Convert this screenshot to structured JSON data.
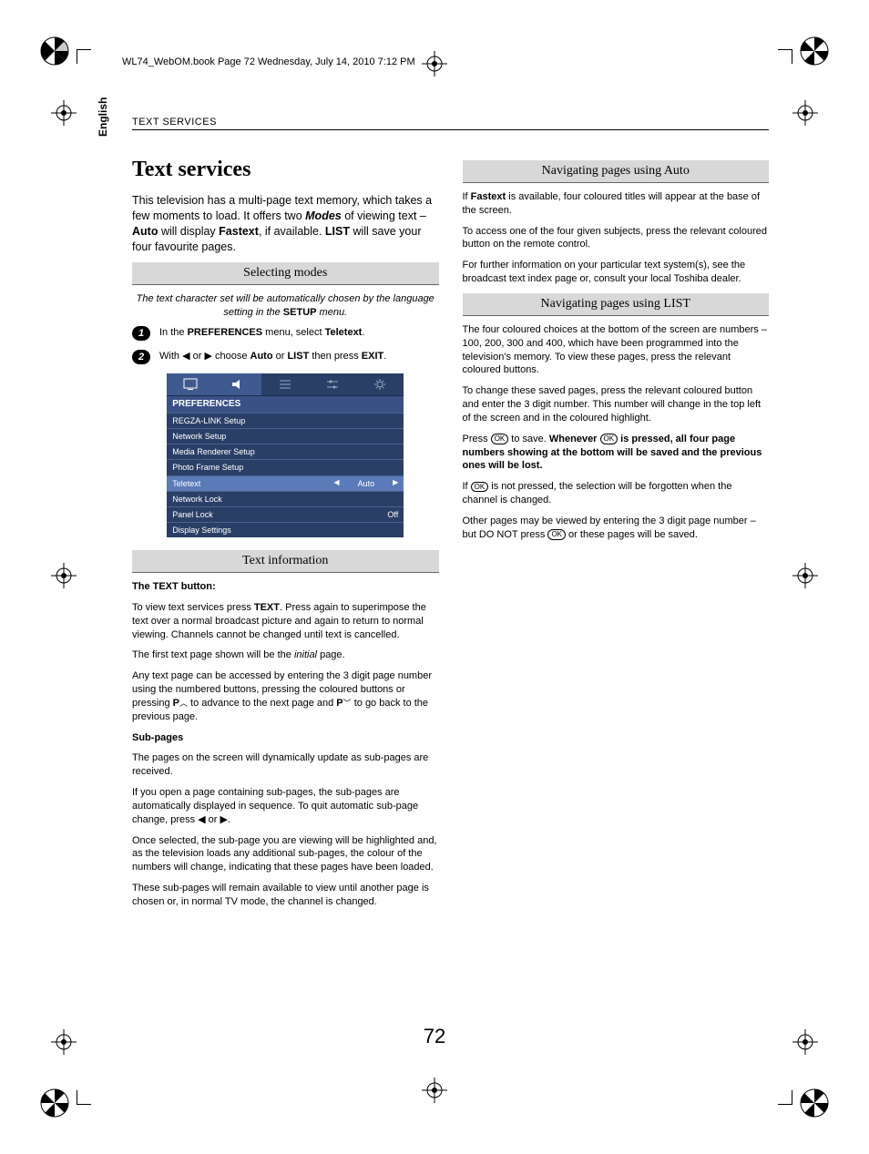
{
  "running_header": "WL74_WebOM.book  Page 72  Wednesday, July 14, 2010  7:12 PM",
  "lang_tab": "English",
  "section_header": "TEXT SERVICES",
  "page_number": "72",
  "title": "Text services",
  "intro_parts": {
    "p1": "This television has a multi-page text memory, which takes a few moments to load. It offers two ",
    "modes": "Modes",
    "p2": " of viewing text – ",
    "auto": "Auto",
    "p3": " will display ",
    "fastext": "Fastext",
    "p4": ", if available. ",
    "list": "LIST",
    "p5": " will save your four favourite pages."
  },
  "sub_selecting": "Selecting modes",
  "note_ital_parts": {
    "a": "The text character set will be automatically chosen by the language setting in the ",
    "setup": "SETUP",
    "b": " menu."
  },
  "step1_parts": {
    "a": "In the ",
    "pref": "PREFERENCES",
    "b": " menu, select ",
    "tele": "Teletext",
    "c": "."
  },
  "step2_parts": {
    "a": "With ",
    "b": " or ",
    "c": " choose ",
    "auto": "Auto",
    "d": " or ",
    "list": "LIST",
    "e": " then press ",
    "exit": "EXIT",
    "f": "."
  },
  "menu": {
    "title": "PREFERENCES",
    "rows": [
      {
        "label": "REGZA-LINK Setup",
        "value": ""
      },
      {
        "label": "Network Setup",
        "value": ""
      },
      {
        "label": "Media Renderer Setup",
        "value": ""
      },
      {
        "label": "Photo Frame Setup",
        "value": ""
      },
      {
        "label": "Teletext",
        "value": "Auto",
        "hl": true
      },
      {
        "label": "Network Lock",
        "value": ""
      },
      {
        "label": "Panel Lock",
        "value": "Off"
      },
      {
        "label": "Display Settings",
        "value": ""
      }
    ]
  },
  "sub_textinfo": "Text information",
  "textinfo_head": "The TEXT button:",
  "ti_p1_parts": {
    "a": "To view text services press ",
    "text": "TEXT",
    "b": ". Press again to superimpose the text over a normal broadcast picture and again to return to normal viewing. Channels cannot be changed until text is cancelled."
  },
  "ti_p2_parts": {
    "a": "The first text page shown will be the ",
    "initial": "initial",
    "b": " page."
  },
  "ti_p3_parts": {
    "a": "Any text page can be accessed by entering the 3 digit page number using the numbered buttons, pressing the coloured buttons or pressing ",
    "pup": "P",
    "b": " to advance to the next page and ",
    "pdn": "P",
    "c": " to go back to the previous page."
  },
  "subpages_head": "Sub-pages",
  "sp_p1": "The pages on the screen will dynamically update as sub-pages are received.",
  "sp_p2_parts": {
    "a": "If you open a page containing sub-pages, the sub-pages are automatically displayed in sequence. To quit automatic sub-page change, press ",
    "b": " or ",
    "c": "."
  },
  "sp_p3": "Once selected, the sub-page you are viewing will be highlighted and, as the television loads any additional sub-pages, the colour of the numbers will change, indicating that these pages have been loaded.",
  "sp_p4": "These sub-pages will remain available to view until another page is chosen or, in normal TV mode, the channel is changed.",
  "sub_nav_auto": "Navigating pages using Auto",
  "na_p1_parts": {
    "a": "If ",
    "fastext": "Fastext",
    "b": " is available, four coloured titles will appear at the base of the screen."
  },
  "na_p2": "To access one of the four given subjects, press the relevant coloured button on the remote control.",
  "na_p3": "For further information on your particular text system(s), see the broadcast text index page or, consult your local Toshiba dealer.",
  "sub_nav_list": "Navigating pages using LIST",
  "nl_p1": "The four coloured choices at the bottom of the screen are numbers – 100, 200, 300 and 400, which have been programmed into the television's memory. To view these pages, press the relevant coloured buttons.",
  "nl_p2": "To change these saved pages, press the relevant coloured button and enter the 3 digit number. This number will change in the top left of the screen and in the coloured highlight.",
  "nl_p3_parts": {
    "a": "Press ",
    "b": " to save. ",
    "c": "Whenever ",
    "d": " is pressed, all four page numbers showing at the bottom will be saved and the previous ones will be lost."
  },
  "nl_p4_parts": {
    "a": "If ",
    "b": " is not pressed, the selection will be forgotten when the channel is changed."
  },
  "nl_p5_parts": {
    "a": "Other pages may be viewed by entering the 3 digit page number – but DO NOT press ",
    "b": " or these pages will be saved."
  },
  "ok_label": "OK"
}
